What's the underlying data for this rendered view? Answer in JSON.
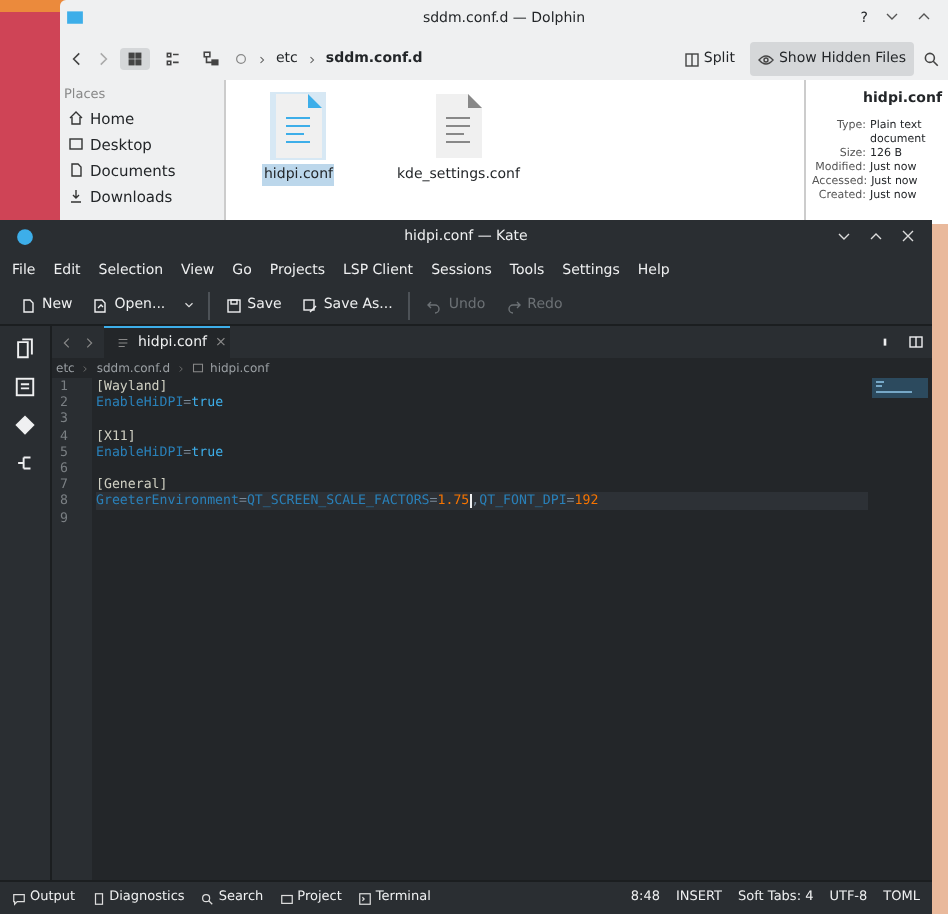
{
  "dolphin": {
    "title": "sddm.conf.d — Dolphin",
    "help": "?",
    "breadcrumb": [
      {
        "label": "etc",
        "current": false
      },
      {
        "label": "sddm.conf.d",
        "current": true
      }
    ],
    "toolbar_right": [
      {
        "label": "Split",
        "pressed": false
      },
      {
        "label": "Show Hidden Files",
        "pressed": true
      }
    ],
    "places": {
      "heading": "Places",
      "items": [
        {
          "label": "Home"
        },
        {
          "label": "Desktop"
        },
        {
          "label": "Documents"
        },
        {
          "label": "Downloads"
        }
      ]
    },
    "files": [
      {
        "name": "hidpi.conf",
        "selected": true
      },
      {
        "name": "kde_settings.conf",
        "selected": false
      }
    ],
    "info": {
      "title": "hidpi.conf",
      "rows": [
        {
          "label": "Type:",
          "value": "Plain text document"
        },
        {
          "label": "Size:",
          "value": "126 B"
        },
        {
          "label": "Modified:",
          "value": "Just now"
        },
        {
          "label": "Accessed:",
          "value": "Just now"
        },
        {
          "label": "Created:",
          "value": "Just now"
        }
      ]
    }
  },
  "kate": {
    "title": "hidpi.conf — Kate",
    "menu": [
      "File",
      "Edit",
      "Selection",
      "View",
      "Go",
      "Projects",
      "LSP Client",
      "Sessions",
      "Tools",
      "Settings",
      "Help"
    ],
    "toolbar": [
      {
        "label": "New",
        "disabled": false
      },
      {
        "label": "Open...",
        "disabled": false,
        "dropdown": true
      },
      {
        "label": "Save",
        "disabled": false
      },
      {
        "label": "Save As...",
        "disabled": false
      },
      {
        "label": "Undo",
        "disabled": true
      },
      {
        "label": "Redo",
        "disabled": true
      }
    ],
    "tab": {
      "label": "hidpi.conf",
      "close": "×"
    },
    "path": [
      "etc",
      "sddm.conf.d",
      "hidpi.conf"
    ],
    "lines": [
      {
        "number": "1",
        "current": false,
        "tokens": [
          {
            "text": "[Wayland]",
            "kind": "section"
          }
        ]
      },
      {
        "number": "2",
        "current": false,
        "tokens": [
          {
            "text": "EnableHiDPI",
            "kind": "key"
          },
          {
            "text": "=",
            "kind": "op"
          },
          {
            "text": "true",
            "kind": "bool"
          }
        ]
      },
      {
        "number": "3",
        "current": false
      },
      {
        "number": "4",
        "current": false,
        "tokens": [
          {
            "text": "[X11]",
            "kind": "section"
          }
        ]
      },
      {
        "number": "5",
        "current": false,
        "tokens": [
          {
            "text": "EnableHiDPI",
            "kind": "key"
          },
          {
            "text": "=",
            "kind": "op"
          },
          {
            "text": "true",
            "kind": "bool"
          }
        ]
      },
      {
        "number": "6",
        "current": false
      },
      {
        "number": "7",
        "current": false,
        "tokens": [
          {
            "text": "[General]",
            "kind": "section"
          }
        ]
      },
      {
        "number": "8",
        "current": true,
        "tokens": [
          {
            "text": "GreeterEnvironment",
            "kind": "key"
          },
          {
            "text": "=",
            "kind": "op"
          },
          {
            "text": "QT_SCREEN_SCALE_FACTORS",
            "kind": "key"
          },
          {
            "text": "=",
            "kind": "op"
          },
          {
            "text": "1.75",
            "kind": "number",
            "caret": true
          },
          {
            "text": ",",
            "kind": "op"
          },
          {
            "text": "QT_FONT_DPI",
            "kind": "key"
          },
          {
            "text": "=",
            "kind": "op"
          },
          {
            "text": "192",
            "kind": "number"
          }
        ]
      },
      {
        "number": "9",
        "current": false
      }
    ],
    "panels": [
      "Output",
      "Diagnostics",
      "Search",
      "Project",
      "Terminal"
    ],
    "status": [
      "8:48",
      "INSERT",
      "Soft Tabs: 4",
      "UTF-8",
      "TOML"
    ]
  }
}
